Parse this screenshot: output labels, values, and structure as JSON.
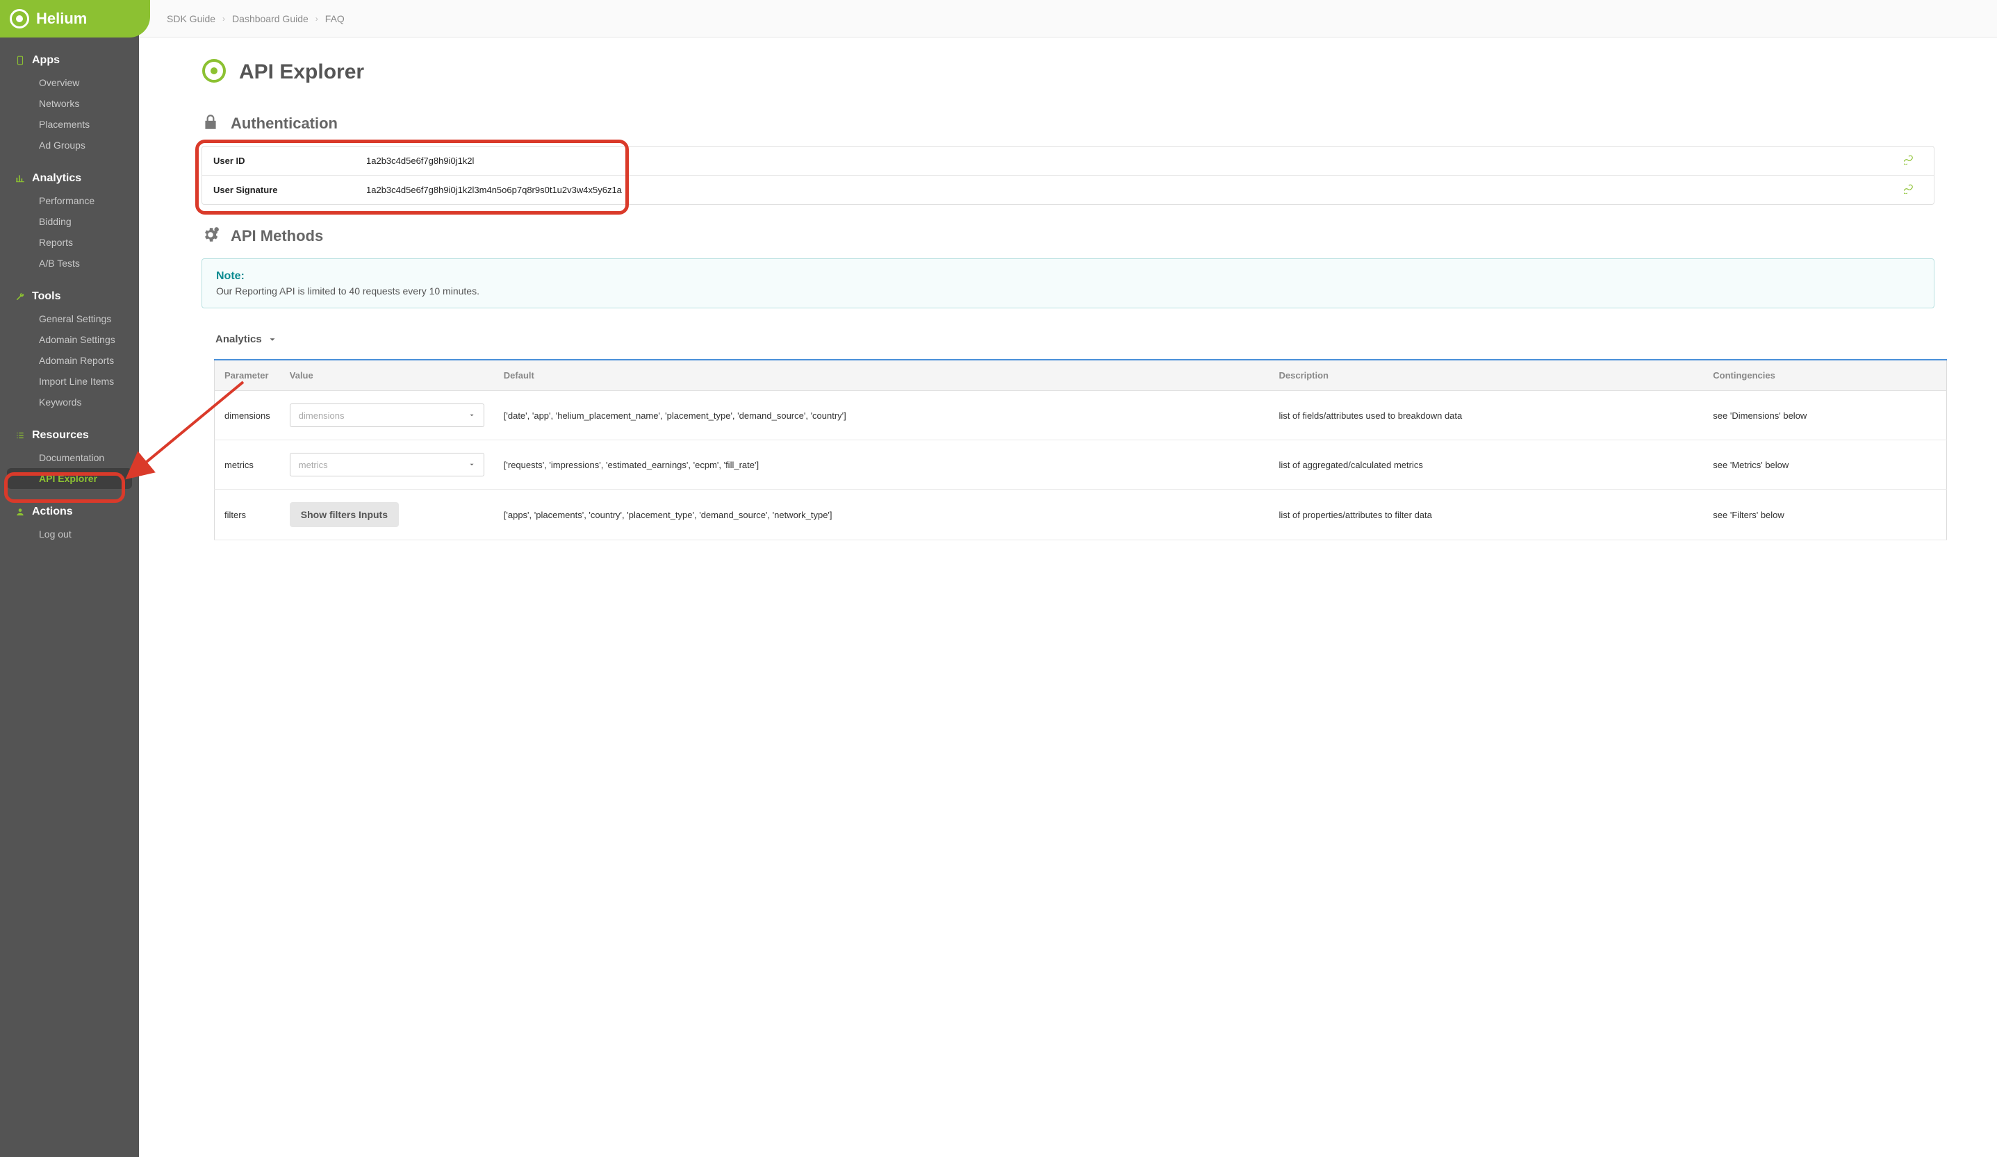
{
  "brand": {
    "name": "Helium"
  },
  "topbar": {
    "crumbs": [
      "SDK Guide",
      "Dashboard Guide",
      "FAQ"
    ]
  },
  "sidebar": {
    "sections": [
      {
        "title": "Apps",
        "icon": "app",
        "items": [
          "Overview",
          "Networks",
          "Placements",
          "Ad Groups"
        ]
      },
      {
        "title": "Analytics",
        "icon": "chart",
        "items": [
          "Performance",
          "Bidding",
          "Reports",
          "A/B Tests"
        ]
      },
      {
        "title": "Tools",
        "icon": "wrench",
        "items": [
          "General Settings",
          "Adomain Settings",
          "Adomain Reports",
          "Import Line Items",
          "Keywords"
        ]
      },
      {
        "title": "Resources",
        "icon": "list",
        "items": [
          "Documentation",
          "API Explorer"
        ]
      },
      {
        "title": "Actions",
        "icon": "user",
        "items": [
          "Log out"
        ]
      }
    ],
    "active": "API Explorer"
  },
  "page": {
    "title": "API Explorer",
    "auth_section": "Authentication",
    "methods_section": "API Methods",
    "note_title": "Note:",
    "note_body": "Our Reporting API is limited to 40 requests every 10 minutes.",
    "collapser": "Analytics"
  },
  "auth": {
    "rows": [
      {
        "label": "User ID",
        "value": "1a2b3c4d5e6f7g8h9i0j1k2l"
      },
      {
        "label": "User Signature",
        "value": "1a2b3c4d5e6f7g8h9i0j1k2l3m4n5o6p7q8r9s0t1u2v3w4x5y6z1a"
      }
    ]
  },
  "params": {
    "headers": [
      "Parameter",
      "Value",
      "Default",
      "Description",
      "Contingencies"
    ],
    "rows": [
      {
        "name": "dimensions",
        "value_placeholder": "dimensions",
        "value_type": "select",
        "default": "['date', 'app', 'helium_placement_name', 'placement_type', 'demand_source', 'country']",
        "description": "list of fields/attributes used to breakdown data",
        "contingencies": "see 'Dimensions' below"
      },
      {
        "name": "metrics",
        "value_placeholder": "metrics",
        "value_type": "select",
        "default": "['requests', 'impressions', 'estimated_earnings', 'ecpm', 'fill_rate']",
        "description": "list of aggregated/calculated metrics",
        "contingencies": "see 'Metrics' below"
      },
      {
        "name": "filters",
        "value_placeholder": "Show filters Inputs",
        "value_type": "button",
        "default": "['apps', 'placements', 'country', 'placement_type', 'demand_source', 'network_type']",
        "description": "list of properties/attributes to filter data",
        "contingencies": "see 'Filters' below"
      }
    ]
  },
  "annotations": {
    "auth_highlight": true,
    "api_explorer_highlight": true,
    "arrow": true
  }
}
